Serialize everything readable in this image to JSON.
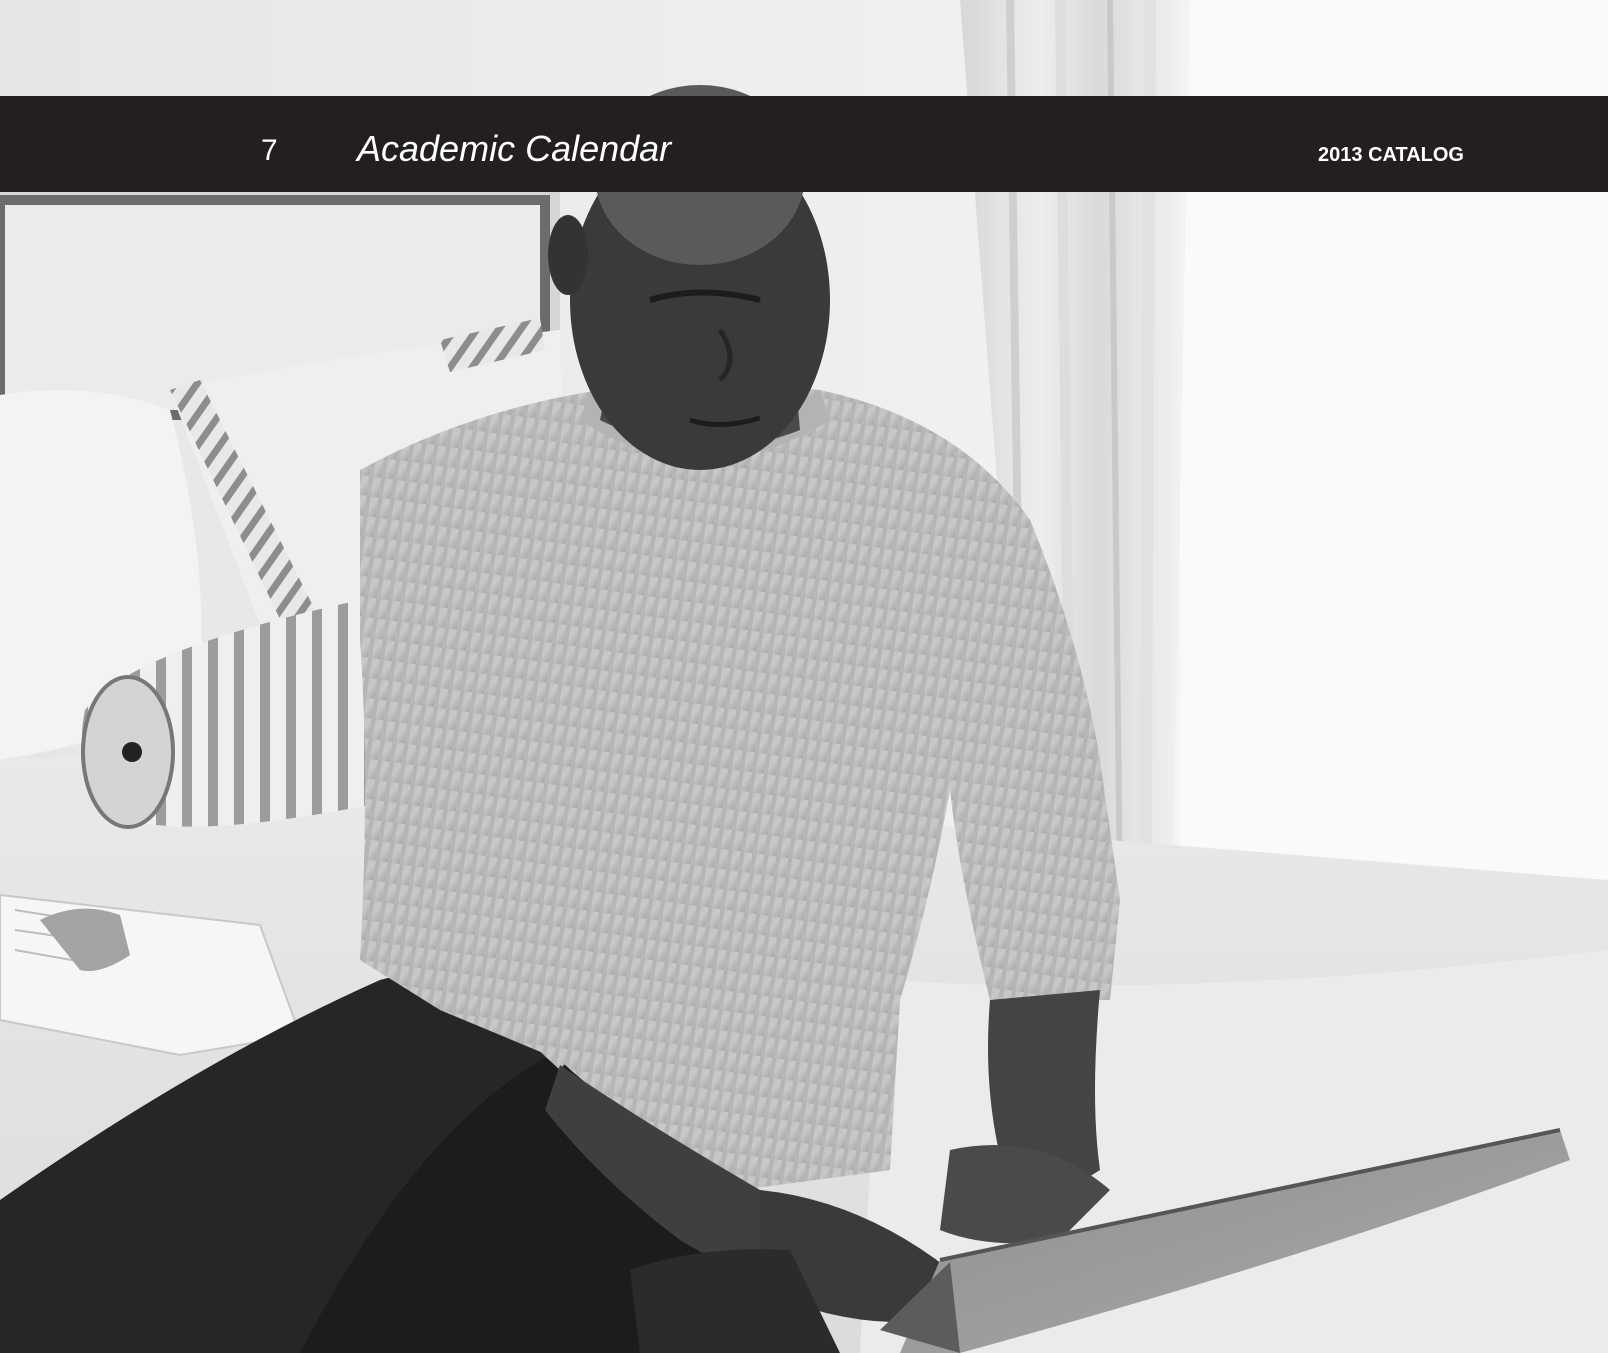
{
  "header": {
    "page_number": "7",
    "title": "Academic Calendar",
    "catalog_label": "2013 CATALOG"
  },
  "photo": {
    "subject": "man-using-laptop-on-bed-photo"
  },
  "colors": {
    "band": "#231f20",
    "header_text": "#ffffff"
  }
}
